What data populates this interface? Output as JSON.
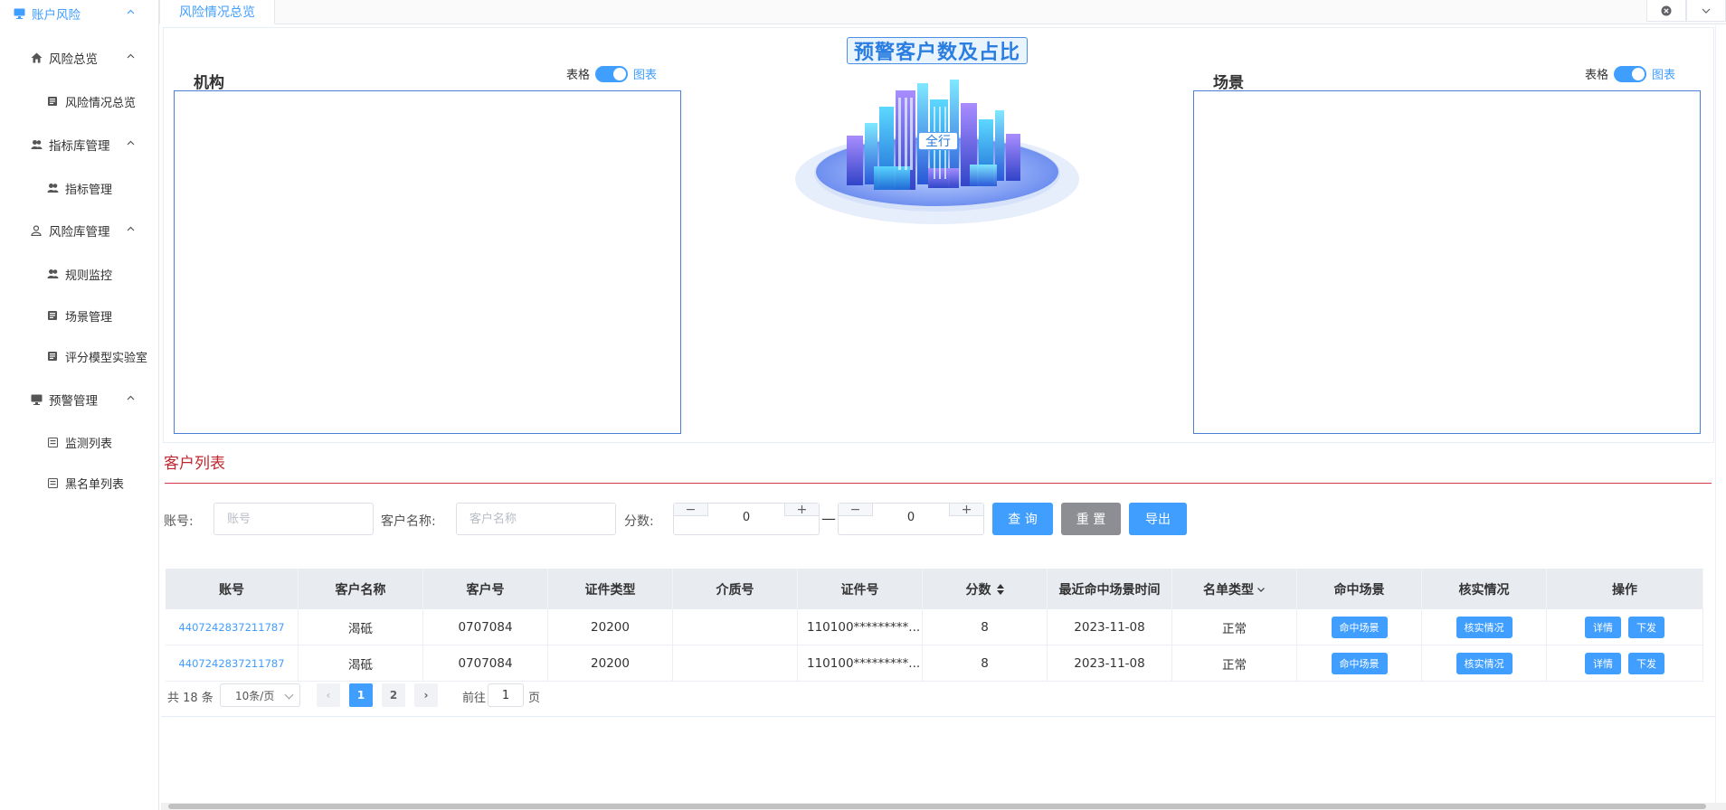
{
  "sidebar": {
    "items": [
      {
        "label": "账户风险",
        "icon": "monitor-icon",
        "level": 1,
        "active": true
      },
      {
        "label": "风险总览",
        "icon": "home-icon",
        "level": 2
      },
      {
        "label": "风险情况总览",
        "icon": "document-icon",
        "level": 3
      },
      {
        "label": "指标库管理",
        "icon": "users-icon",
        "level": 2
      },
      {
        "label": "指标管理",
        "icon": "users-icon",
        "level": 3
      },
      {
        "label": "风险库管理",
        "icon": "user-icon",
        "level": 2
      },
      {
        "label": "规则监控",
        "icon": "users-icon",
        "level": 3
      },
      {
        "label": "场景管理",
        "icon": "document-icon",
        "level": 3
      },
      {
        "label": "评分模型实验室",
        "icon": "document-icon",
        "level": 3
      },
      {
        "label": "预警管理",
        "icon": "monitor-icon",
        "level": 2
      },
      {
        "label": "监测列表",
        "icon": "list-icon",
        "level": 3
      },
      {
        "label": "黑名单列表",
        "icon": "list-icon",
        "level": 3
      }
    ]
  },
  "tabs": {
    "active_label": "风险情况总览"
  },
  "overview": {
    "center_title": "预警客户数及占比",
    "center_label": "全行",
    "left_title": "机构",
    "right_title": "场景",
    "toggle_table": "表格",
    "toggle_chart": "图表"
  },
  "customers": {
    "title": "客户列表",
    "filters": {
      "account_label": "账号:",
      "account_placeholder": "账号",
      "name_label": "客户名称:",
      "name_placeholder": "客户名称",
      "score_label": "分数:",
      "score_min": "0",
      "score_max": "0",
      "dash": "—",
      "minus": "−",
      "plus": "+"
    },
    "buttons": {
      "query": "查 询",
      "reset": "重 置",
      "export": "导出"
    },
    "columns": [
      "账号",
      "客户名称",
      "客户号",
      "证件类型",
      "介质号",
      "证件号",
      "分数",
      "最近命中场景时间",
      "名单类型",
      "命中场景",
      "核实情况",
      "操作"
    ],
    "rows": [
      {
        "account": "4407242837211787",
        "name": "渴砥",
        "customer_no": "0707084",
        "id_type": "20200",
        "medium_no": "",
        "id_no": "110100*********...",
        "score": "8",
        "last_hit": "2023-11-08",
        "list_type": "正常"
      },
      {
        "account": "4407242837211787",
        "name": "渴砥",
        "customer_no": "0707084",
        "id_type": "20200",
        "medium_no": "",
        "id_no": "110100*********...",
        "score": "8",
        "last_hit": "2023-11-08",
        "list_type": "正常"
      }
    ],
    "row_buttons": {
      "hit_scene": "命中场景",
      "verify": "核实情况",
      "detail": "详情",
      "issue": "下发"
    }
  },
  "pagination": {
    "total": "共 18 条",
    "page_size": "10条/页",
    "pages": [
      "1",
      "2"
    ],
    "current": "1",
    "prev": "‹",
    "next": "›",
    "goto_prefix": "前往",
    "goto_value": "1",
    "goto_suffix": "页"
  },
  "colors": {
    "accent": "#409eff",
    "section_title": "#c0262f"
  }
}
